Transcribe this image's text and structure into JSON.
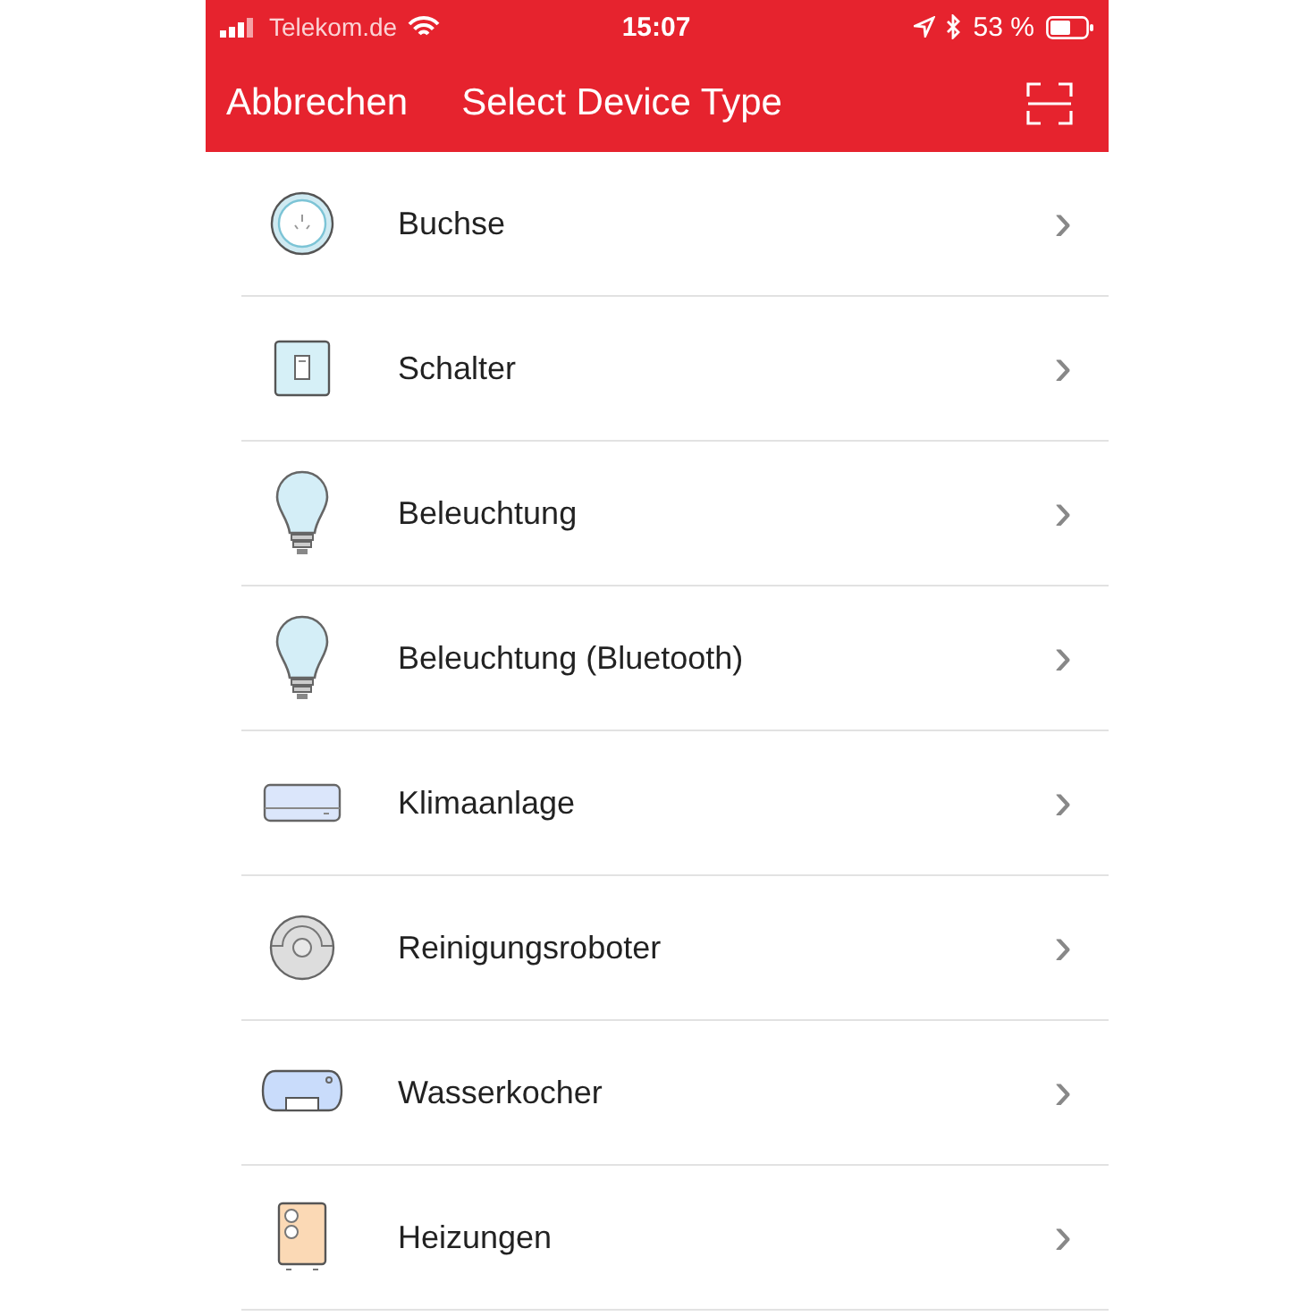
{
  "status_bar": {
    "carrier": "Telekom.de",
    "time": "15:07",
    "battery": "53 %"
  },
  "nav_bar": {
    "cancel": "Abbrechen",
    "title": "Select Device Type"
  },
  "devices": [
    {
      "kind": "socket",
      "label": "Buchse",
      "chevron": "›"
    },
    {
      "kind": "switch",
      "label": "Schalter",
      "chevron": "›"
    },
    {
      "kind": "bulb",
      "label": "Beleuchtung",
      "chevron": "›"
    },
    {
      "kind": "bulb",
      "label": "Beleuchtung (Bluetooth)",
      "chevron": "›"
    },
    {
      "kind": "aircon",
      "label": "Klimaanlage",
      "chevron": "›"
    },
    {
      "kind": "robot",
      "label": "Reinigungsroboter",
      "chevron": "›"
    },
    {
      "kind": "kettle",
      "label": "Wasserkocher",
      "chevron": "›"
    },
    {
      "kind": "heater",
      "label": "Heizungen",
      "chevron": "›"
    }
  ]
}
